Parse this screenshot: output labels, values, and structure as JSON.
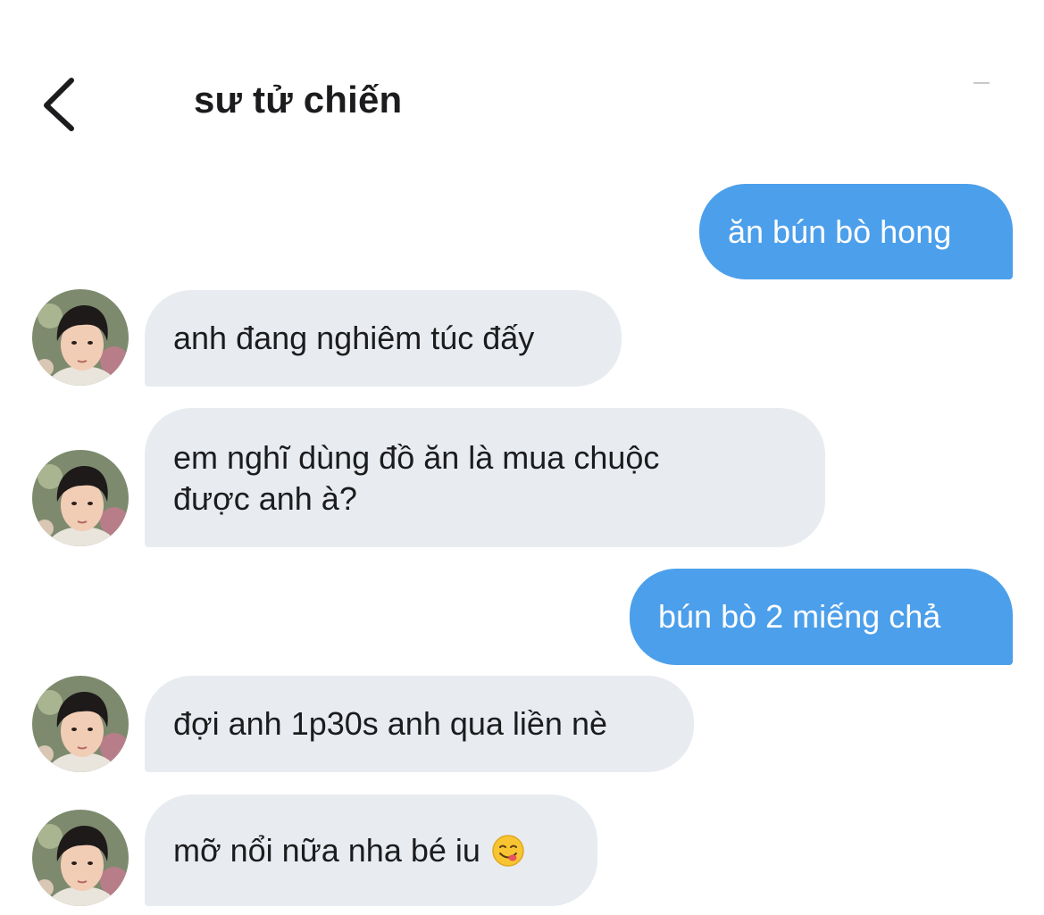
{
  "header": {
    "title": "sư tử chiến"
  },
  "messages": [
    {
      "from": "me",
      "text": "ăn bún bò hong"
    },
    {
      "from": "contact",
      "text": "anh đang nghiêm túc đấy"
    },
    {
      "from": "contact",
      "line1": "em nghĩ dùng đồ ăn là mua chuộc",
      "line2": "được anh à?"
    },
    {
      "from": "me",
      "text": "bún bò 2 miếng chả"
    },
    {
      "from": "contact",
      "text": "đợi anh 1p30s anh qua liền nè"
    },
    {
      "from": "contact",
      "text": "mỡ nổi nữa nha bé iu",
      "emoji": "😋"
    }
  ],
  "colors": {
    "outgoing_bubble": "#4c9fea",
    "incoming_bubble": "#e8ecf0",
    "title_text": "#1c1c1e"
  }
}
